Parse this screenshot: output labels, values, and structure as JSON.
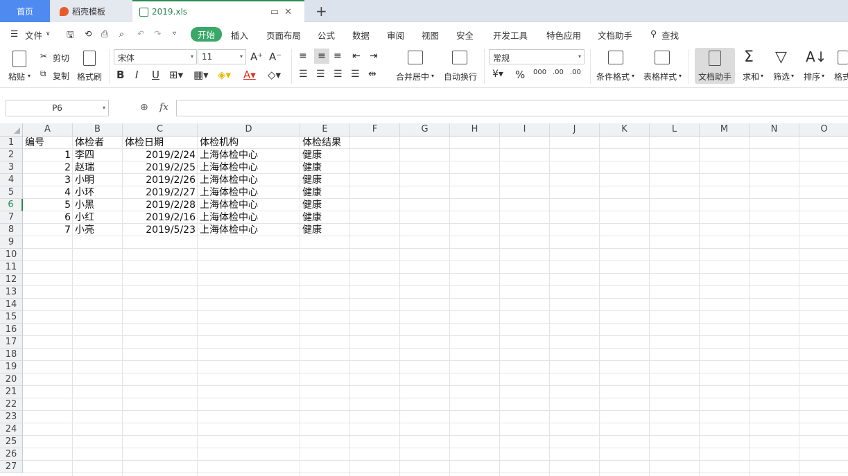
{
  "tabs": {
    "home": "首页",
    "template": "稻壳模板",
    "file": "2019.xls",
    "new": "+"
  },
  "menu": {
    "file": "文件",
    "items": [
      "开始",
      "插入",
      "页面布局",
      "公式",
      "数据",
      "审阅",
      "视图",
      "安全",
      "开发工具",
      "特色应用",
      "文档助手"
    ],
    "search": "查找"
  },
  "ribbon": {
    "paste": "粘贴",
    "cut": "剪切",
    "copy": "复制",
    "format_painter": "格式刷",
    "font_name": "宋体",
    "font_size": "11",
    "merge_center": "合并居中",
    "auto_wrap": "自动换行",
    "number_format": "常规",
    "cond_format": "条件格式",
    "table_style": "表格样式",
    "doc_helper": "文档助手",
    "sum": "求和",
    "filter": "筛选",
    "sort": "排序",
    "format": "格式"
  },
  "formula_bar": {
    "cell_ref": "P6",
    "fx": "fx",
    "content": ""
  },
  "sheet": {
    "columns": [
      "A",
      "B",
      "C",
      "D",
      "E",
      "F",
      "G",
      "H",
      "I",
      "J",
      "K",
      "L",
      "M",
      "N",
      "O"
    ],
    "rows": [
      1,
      2,
      3,
      4,
      5,
      6,
      7,
      8,
      9,
      10,
      11,
      12,
      13,
      14,
      15,
      16,
      17,
      18,
      19,
      20,
      21,
      22,
      23,
      24,
      25,
      26,
      27
    ],
    "active_row": 6,
    "header": [
      "编号",
      "体检者",
      "体检日期",
      "体检机构",
      "体检结果"
    ],
    "data": [
      [
        "1",
        "李四",
        "2019/2/24",
        "上海体检中心",
        "健康"
      ],
      [
        "2",
        "赵瑞",
        "2019/2/25",
        "上海体检中心",
        "健康"
      ],
      [
        "3",
        "小明",
        "2019/2/26",
        "上海体检中心",
        "健康"
      ],
      [
        "4",
        "小环",
        "2019/2/27",
        "上海体检中心",
        "健康"
      ],
      [
        "5",
        "小黑",
        "2019/2/28",
        "上海体检中心",
        "健康"
      ],
      [
        "6",
        "小红",
        "2019/2/16",
        "上海体检中心",
        "健康"
      ],
      [
        "7",
        "小亮",
        "2019/5/23",
        "上海体检中心",
        "健康"
      ]
    ]
  }
}
